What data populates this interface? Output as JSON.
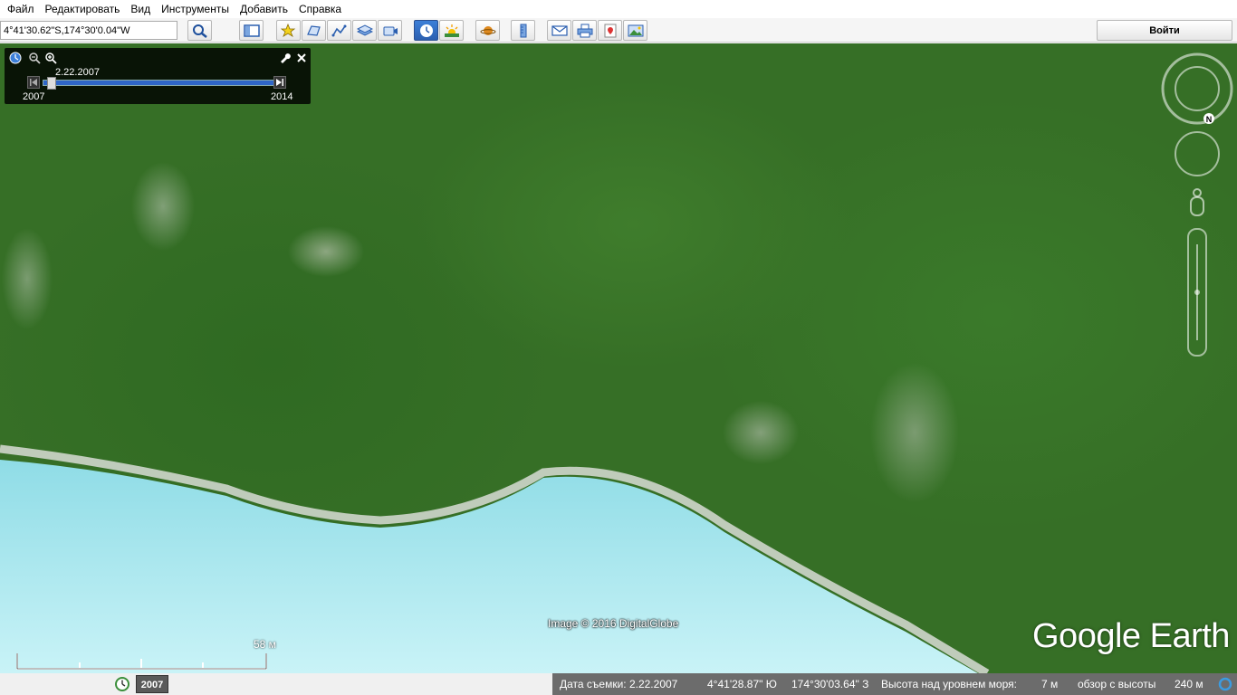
{
  "menu": [
    "Файл",
    "Редактировать",
    "Вид",
    "Инструменты",
    "Добавить",
    "Справка"
  ],
  "search": {
    "value": "4°41'30.62\"S,174°30'0.04\"W"
  },
  "toolbar": {
    "login_label": "Войти",
    "icons": [
      "search-icon",
      "sidebar-icon",
      "placemark-icon",
      "polygon-icon",
      "path-icon",
      "overlay-icon",
      "tour-icon",
      "historical-imagery-icon",
      "sun-icon",
      "planets-icon",
      "ruler-icon",
      "email-icon",
      "print-icon",
      "maps-icon",
      "save-image-icon"
    ]
  },
  "time_slider": {
    "date": "2.22.2007",
    "start_year": "2007",
    "end_year": "2014",
    "position": 0.02
  },
  "map": {
    "attribution": "Image © 2016 DigitalGlobe",
    "logo": "Google Earth",
    "scale_label": "58 м",
    "year_badge": "2007",
    "compass_letter": "N"
  },
  "status": {
    "date": "Дата съемки: 2.22.2007",
    "lat": "4°41'28.87\" Ю",
    "lon": "174°30'03.64\" З",
    "elev_label": "Высота над уровнем моря:",
    "elev_value": "7 м",
    "eye_label": "обзор с высоты",
    "eye_value": "240 м"
  },
  "colors": {
    "forest": "#366f26",
    "water": "#a9e6ef",
    "beach": "#d8ddd6",
    "slider": "#2f66c8"
  }
}
